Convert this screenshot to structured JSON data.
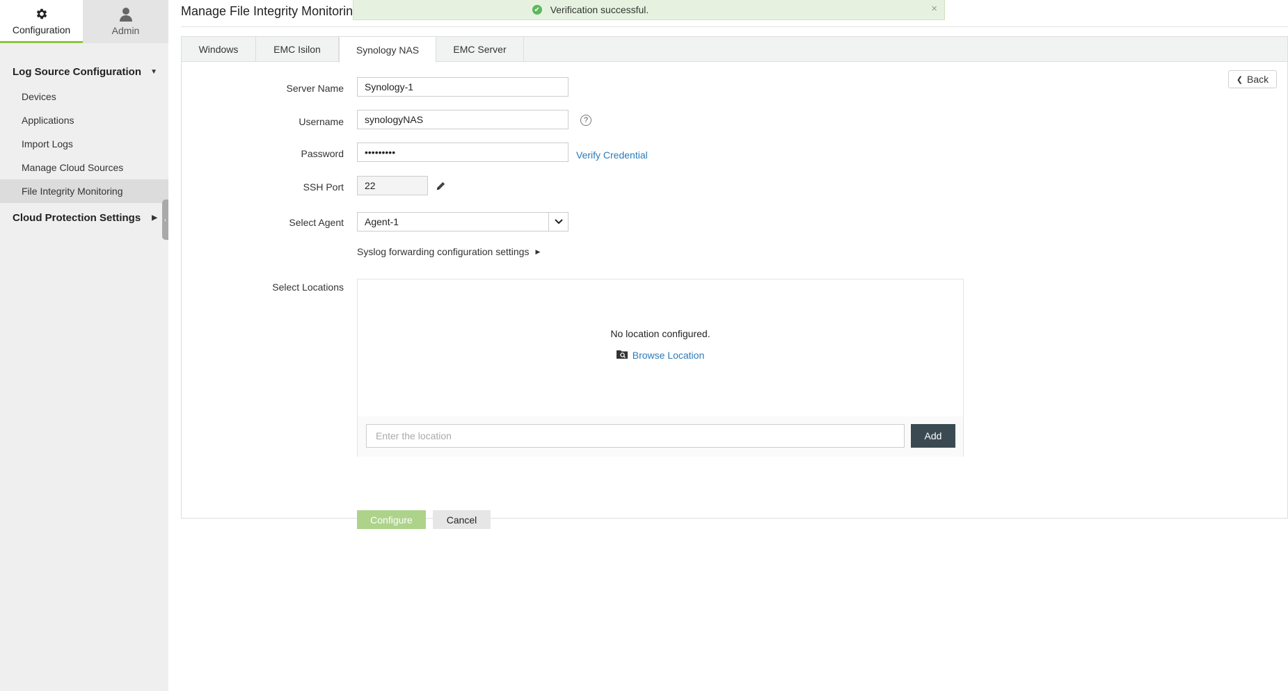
{
  "sidebar": {
    "top_tabs": [
      {
        "label": "Configuration",
        "icon": "gear-icon",
        "active": true
      },
      {
        "label": "Admin",
        "icon": "user-icon",
        "active": false
      }
    ],
    "sections": [
      {
        "label": "Log Source Configuration",
        "expanded": true,
        "items": [
          "Devices",
          "Applications",
          "Import Logs",
          "Manage Cloud Sources",
          "File Integrity Monitoring"
        ]
      },
      {
        "label": "Cloud Protection Settings",
        "expanded": false
      }
    ],
    "active_item": "File Integrity Monitoring"
  },
  "header": {
    "title": "Manage File Integrity Monitorin"
  },
  "toast": {
    "message": "Verification successful.",
    "close": "×"
  },
  "tabs": [
    "Windows",
    "EMC Isilon",
    "Synology NAS",
    "EMC Server"
  ],
  "active_tab": "Synology NAS",
  "back_label": "Back",
  "form": {
    "server_name": {
      "label": "Server Name",
      "value": "Synology-1"
    },
    "username": {
      "label": "Username",
      "value": "synologyNAS",
      "help": "?"
    },
    "password": {
      "label": "Password",
      "value": "•••••••••",
      "verify_link": "Verify Credential"
    },
    "ssh_port": {
      "label": "SSH Port",
      "value": "22"
    },
    "agent": {
      "label": "Select Agent",
      "value": "Agent-1"
    },
    "syslog_link": "Syslog forwarding configuration settings",
    "locations": {
      "label": "Select Locations",
      "empty_text": "No location configured.",
      "browse_label": "Browse Location",
      "input_placeholder": "Enter the location",
      "add_label": "Add"
    },
    "configure_label": "Configure",
    "cancel_label": "Cancel"
  },
  "colors": {
    "accent_green": "#8dc63f",
    "link_blue": "#2a7ab8",
    "dark_button": "#3b4a52",
    "toast_bg": "#e6f2df"
  }
}
